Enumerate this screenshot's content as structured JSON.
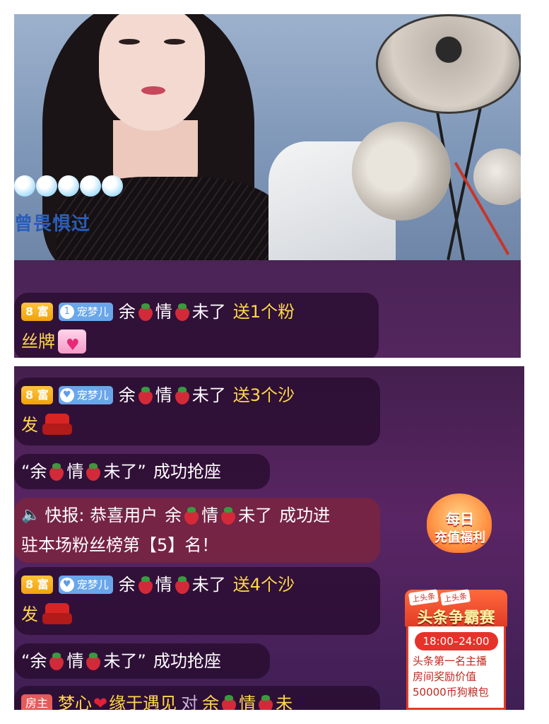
{
  "video": {
    "overlay_text": "曾畏惧过",
    "indicator_dots": 5
  },
  "chat_top": [
    {
      "rich_level": "8 富",
      "fan_club": "宠梦儿",
      "fan_level": "1",
      "user_parts": [
        "余",
        "情",
        "未了"
      ],
      "action": "送1个粉",
      "action_cont": "丝牌",
      "gift": "fan-badge-gift-icon"
    }
  ],
  "chat_bottom": {
    "msg1": {
      "rich_level": "8 富",
      "fan_club": "宠梦儿",
      "user_parts": [
        "余",
        "情",
        "未了"
      ],
      "action": "送3个沙",
      "action_cont": "发"
    },
    "seat1": {
      "open_quote": "“余",
      "mid": "情",
      "close_quote": "未了”",
      "suffix": "成功抢座"
    },
    "alert": {
      "label": "快报: 恭喜用户",
      "user_parts": [
        "余",
        "情",
        "未了"
      ],
      "suffix1": "成功进",
      "line2": "驻本场粉丝榜第【5】名！"
    },
    "msg2": {
      "rich_level": "8 富",
      "fan_club": "宠梦儿",
      "user_parts": [
        "余",
        "情",
        "未了"
      ],
      "action": "送4个沙",
      "action_cont": "发"
    },
    "seat2": {
      "open_quote": "“余",
      "mid": "情",
      "close_quote": "未了”",
      "suffix": "成功抢座"
    },
    "host_msg": {
      "role": "房主",
      "sender_a": "梦心",
      "sender_b": "缘于遇见",
      "to": "对",
      "target_parts": [
        "余",
        "情",
        "未"
      ]
    }
  },
  "promos": {
    "daily": {
      "line1": "每日",
      "line2": "充值福利"
    },
    "contest": {
      "tag1": "上头条",
      "tag2": "上头条",
      "title": "头条争霸赛",
      "time": "18:00–24:00",
      "desc1": "头条第一名主播",
      "desc2": "房间奖励价值",
      "desc3": "50000币狗粮包"
    }
  },
  "colors": {
    "gift_text": "#ffd84a",
    "rich_badge": "#f1a20c",
    "fan_badge": "#6aa7ea",
    "host_badge": "#e55b5b"
  }
}
